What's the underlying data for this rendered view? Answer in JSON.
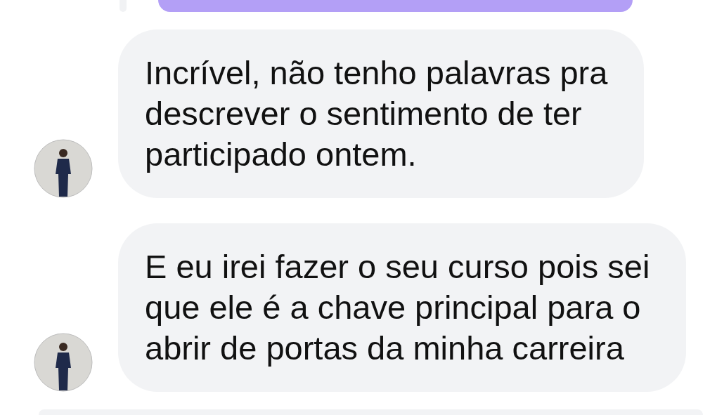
{
  "messages": [
    {
      "kind": "outgoing"
    },
    {
      "kind": "incoming",
      "text": "Incrível, não tenho palavras pra\ndescrever o sentimento de ter\nparticipado ontem."
    },
    {
      "kind": "incoming",
      "text": "E eu irei fazer o seu curso pois sei\nque ele é a chave principal para o\nabrir de portas da minha carreira"
    },
    {
      "kind": "incoming-cut"
    }
  ]
}
